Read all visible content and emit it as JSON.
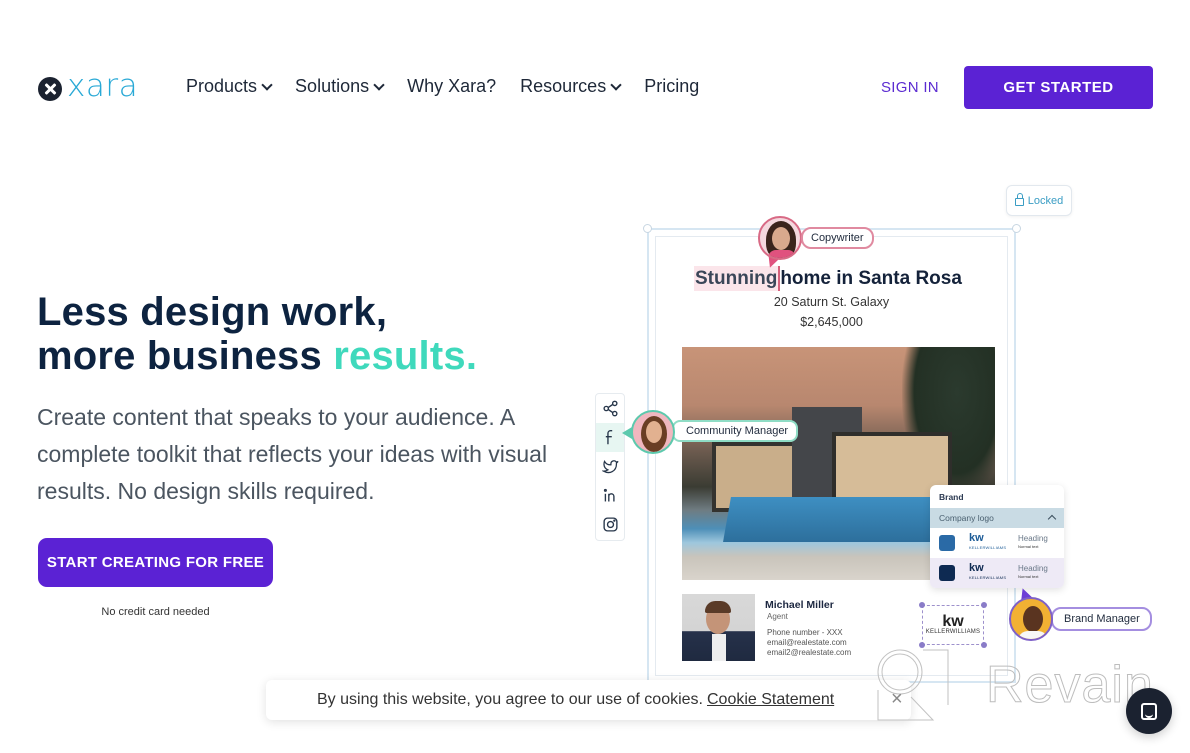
{
  "header": {
    "logo_text": "xara",
    "nav": [
      {
        "label": "Products",
        "has_dropdown": true
      },
      {
        "label": "Solutions",
        "has_dropdown": true
      },
      {
        "label": "Why Xara?",
        "has_dropdown": false
      },
      {
        "label": "Resources",
        "has_dropdown": true
      },
      {
        "label": "Pricing",
        "has_dropdown": false
      }
    ],
    "sign_in": "SIGN IN",
    "get_started": "GET STARTED"
  },
  "hero": {
    "title_line1": "Less design work,",
    "title_line2_prefix": "more business ",
    "title_line2_accent": "results.",
    "subtitle": "Create content that speaks to your audience. A complete toolkit that reflects your ideas with visual results. No design skills required.",
    "cta_label": "START CREATING FOR FREE",
    "cta_note": "No credit card needed"
  },
  "illustration": {
    "locked_label": "Locked",
    "copywriter_label": "Copywriter",
    "community_manager_label": "Community Manager",
    "brand_manager_label": "Brand Manager",
    "listing": {
      "title_highlight": "Stunning",
      "title_rest": "home in Santa Rosa",
      "address": "20 Saturn St. Galaxy",
      "price": "$2,645,000"
    },
    "agent": {
      "name": "Michael Miller",
      "role": "Agent",
      "phone": "Phone number - XXX",
      "email1": "email@realestate.com",
      "email2": "email2@realestate.com"
    },
    "social_icons": [
      "share-icon",
      "facebook-icon",
      "twitter-icon",
      "linkedin-icon",
      "instagram-icon"
    ],
    "brand_panel": {
      "title": "Brand",
      "section": "Company logo",
      "rows": [
        {
          "swatch": "#2a6aa6",
          "logo": "kw",
          "logo_sub": "KELLERWILLIAMS",
          "heading": "Heading",
          "text": "Normal text"
        },
        {
          "swatch": "#0e2a52",
          "logo": "kw",
          "logo_sub": "KELLERWILLIAMS",
          "heading": "Heading",
          "text": "Normal text"
        }
      ]
    },
    "selected_logo": {
      "big": "kw",
      "small": "KELLERWILLIAMS"
    }
  },
  "cookie": {
    "text": "By using this website, you agree to our use of cookies.",
    "link": "Cookie Statement",
    "close": "×"
  },
  "watermark": {
    "text": "Revain"
  },
  "colors": {
    "primary": "#5b22d4",
    "accent": "#3fd9bc",
    "navy": "#0d2340",
    "logo_blue": "#29a9d6"
  }
}
